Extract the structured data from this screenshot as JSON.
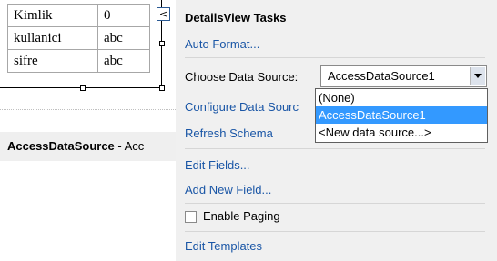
{
  "details_table": {
    "rows": [
      {
        "key": "Kimlik",
        "value": "0"
      },
      {
        "key": "kullanici",
        "value": "abc"
      },
      {
        "key": "sifre",
        "value": "abc"
      }
    ]
  },
  "smart_tag_glyph": "<",
  "data_source_control": {
    "name": "AccessDataSource",
    "suffix": " - Acc"
  },
  "tasks": {
    "title": "DetailsView Tasks",
    "auto_format": "Auto Format...",
    "choose_label": "Choose Data Source:",
    "selected_source": "AccessDataSource1",
    "options": [
      "(None)",
      "AccessDataSource1",
      "<New data source...>"
    ],
    "configure": "Configure Data Sourc",
    "refresh": "Refresh Schema",
    "edit_fields": "Edit Fields...",
    "add_field": "Add New Field...",
    "enable_paging": "Enable Paging",
    "enable_paging_checked": false,
    "edit_templates": "Edit Templates"
  },
  "colors": {
    "link": "#1a56a6",
    "panel_bg": "#f0f0f0",
    "selection": "#3399ff"
  }
}
